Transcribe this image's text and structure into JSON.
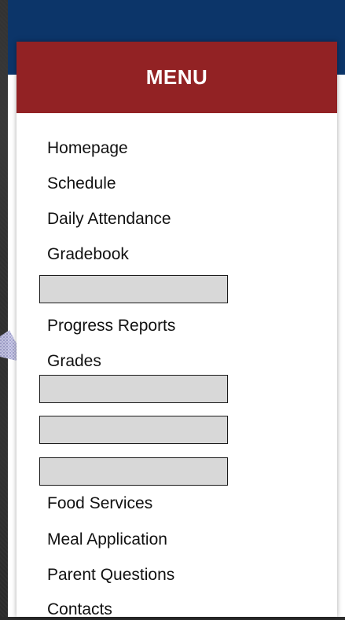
{
  "menu": {
    "title": "MENU",
    "items": [
      {
        "type": "link",
        "label": "Homepage"
      },
      {
        "type": "link",
        "label": "Schedule"
      },
      {
        "type": "link",
        "label": "Daily Attendance"
      },
      {
        "type": "link",
        "label": "Gradebook"
      },
      {
        "type": "redacted"
      },
      {
        "type": "link",
        "label": "Progress Reports"
      },
      {
        "type": "link",
        "label": "Grades"
      },
      {
        "type": "redacted"
      },
      {
        "type": "redacted"
      },
      {
        "type": "redacted"
      },
      {
        "type": "link",
        "label": "Food Services"
      },
      {
        "type": "link",
        "label": "Meal Application"
      },
      {
        "type": "link",
        "label": "Parent Questions"
      },
      {
        "type": "link",
        "label": "Contacts"
      }
    ]
  },
  "colors": {
    "header_red": "#922224",
    "top_bar_blue": "#0c3569",
    "placeholder_gray": "#d8d8d8"
  },
  "icons": {
    "decorative": "arrow-cursor-icon"
  }
}
